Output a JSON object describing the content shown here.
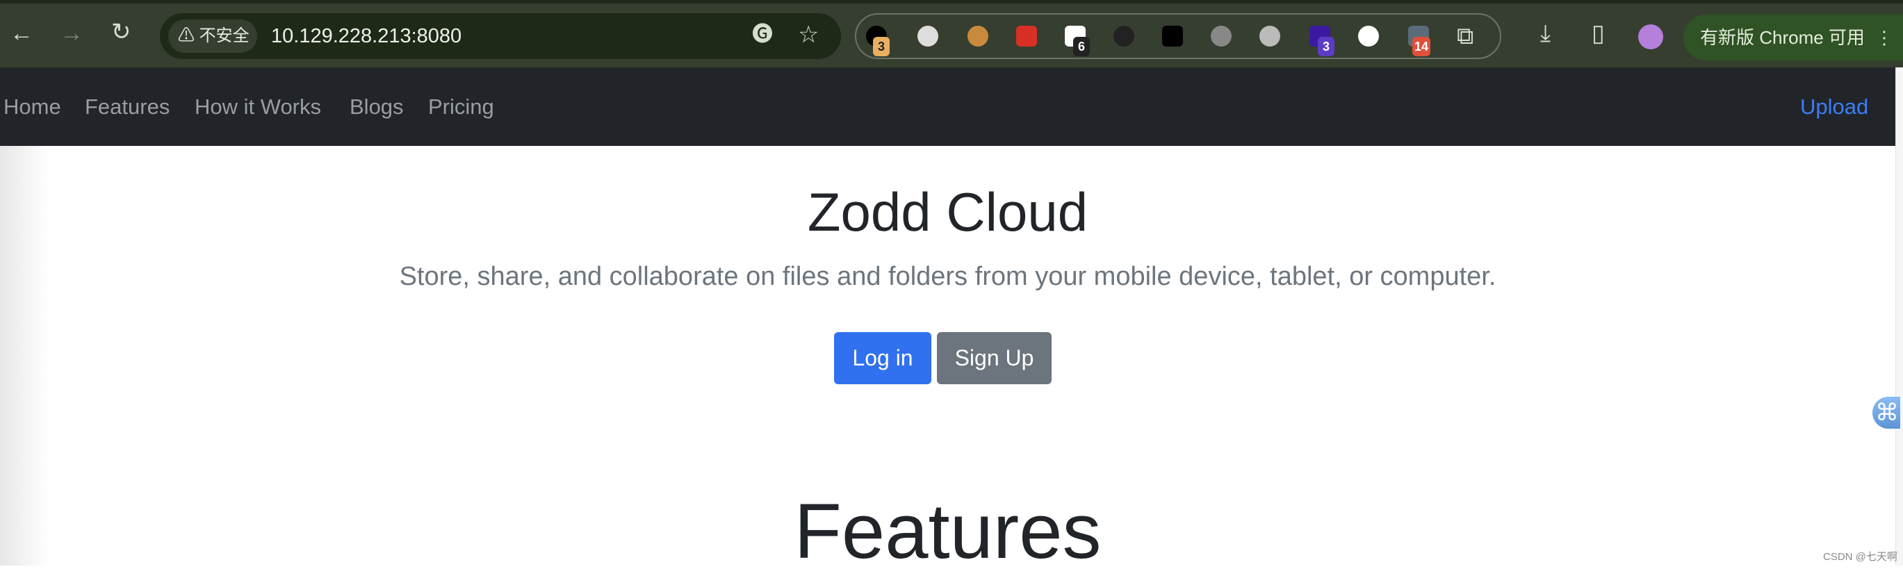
{
  "browser": {
    "security_label": "不安全",
    "url": "10.129.228.213:8080",
    "extension_badges": [
      "3",
      "6",
      "3",
      "14"
    ],
    "update_button": "有新版 Chrome 可用",
    "icons": [
      "back-arrow",
      "forward-arrow",
      "reload",
      "warning",
      "translate",
      "star",
      "extensions-puzzle",
      "download",
      "side-panel",
      "profile-avatar",
      "more-vert"
    ]
  },
  "nav": {
    "items": [
      "Home",
      "Features",
      "How it Works",
      "Blogs",
      "Pricing"
    ],
    "upload": "Upload"
  },
  "hero": {
    "title": "Zodd Cloud",
    "subtitle": "Store, share, and collaborate on files and folders from your mobile device, tablet, or computer.",
    "login": "Log in",
    "signup": "Sign Up"
  },
  "features": {
    "heading": "Features"
  },
  "watermark": "CSDN @七天啊",
  "colors": {
    "primary": "#3171f0",
    "secondary": "#6c757d",
    "navbar": "#212529",
    "link": "#3d7df6"
  }
}
